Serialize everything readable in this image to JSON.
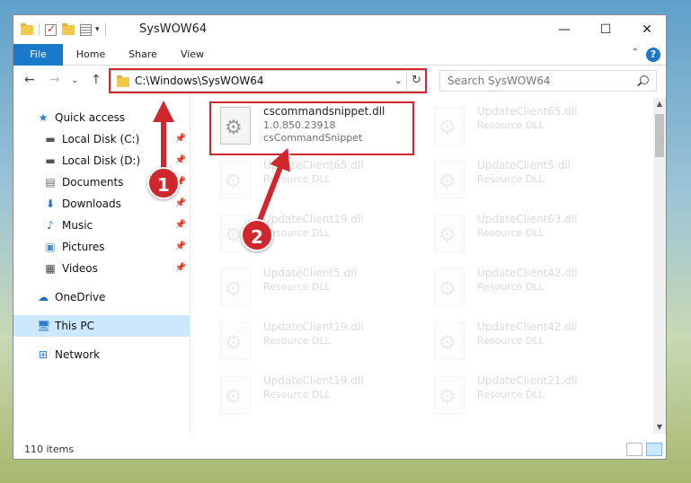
{
  "window": {
    "title": "SysWOW64",
    "minimize_glyph": "—",
    "maximize_glyph": "☐",
    "close_glyph": "✕"
  },
  "ribbon": {
    "tabs": [
      "File",
      "Home",
      "Share",
      "View"
    ],
    "help_glyph": "?",
    "collapse_glyph": "⌃"
  },
  "nav": {
    "back_glyph": "←",
    "forward_glyph": "→",
    "recent_glyph": "⌄",
    "up_glyph": "↑",
    "address_path": "C:\\Windows\\SysWOW64",
    "address_drop_glyph": "⌄",
    "refresh_glyph": "↻",
    "search_placeholder": "Search SysWOW64"
  },
  "sidebar": {
    "items": [
      {
        "label": "Quick access",
        "icon": "star-icon",
        "glyph": "★",
        "color": "#2b7cd3",
        "pinned": false
      },
      {
        "label": "Local Disk (C:)",
        "icon": "drive-icon",
        "glyph": "▬",
        "color": "#555555",
        "pinned": true
      },
      {
        "label": "Local Disk (D:)",
        "icon": "drive-icon",
        "glyph": "▬",
        "color": "#555555",
        "pinned": true
      },
      {
        "label": "Documents",
        "icon": "documents-icon",
        "glyph": "▤",
        "color": "#6a6a6a",
        "pinned": true
      },
      {
        "label": "Downloads",
        "icon": "download-icon",
        "glyph": "⬇",
        "color": "#1f6fc4",
        "pinned": true
      },
      {
        "label": "Music",
        "icon": "music-icon",
        "glyph": "♪",
        "color": "#1f6fc4",
        "pinned": true
      },
      {
        "label": "Pictures",
        "icon": "pictures-icon",
        "glyph": "▣",
        "color": "#4a8fc9",
        "pinned": true
      },
      {
        "label": "Videos",
        "icon": "video-icon",
        "glyph": "▦",
        "color": "#444444",
        "pinned": true
      },
      {
        "label": "OneDrive",
        "icon": "cloud-icon",
        "glyph": "☁",
        "color": "#1f6fc4",
        "pinned": false
      },
      {
        "label": "This PC",
        "icon": "computer-icon",
        "glyph": "🖥",
        "color": "#2b7cd3",
        "pinned": false
      },
      {
        "label": "Network",
        "icon": "network-icon",
        "glyph": "⊞",
        "color": "#2b7cd3",
        "pinned": false
      }
    ],
    "pin_glyph": "📌"
  },
  "files": [
    {
      "name": "cscommandsnippet.dll",
      "version": "1.0.850.23918",
      "description": "csCommandSnippet",
      "faded": false
    },
    {
      "name": "UpdateClient65.dll",
      "version": "Resource DLL",
      "description": "",
      "faded": true
    },
    {
      "name": "UpdateClient65.dll",
      "version": "Resource DLL",
      "description": "",
      "faded": true
    },
    {
      "name": "UpdateClient5.dll",
      "version": "Resource DLL",
      "description": "",
      "faded": true
    },
    {
      "name": "UpdateClient19.dll",
      "version": "Resource DLL",
      "description": "",
      "faded": true
    },
    {
      "name": "UpdateClient63.dll",
      "version": "Resource DLL",
      "description": "",
      "faded": true
    },
    {
      "name": "UpdateClient5.dll",
      "version": "Resource DLL",
      "description": "",
      "faded": true
    },
    {
      "name": "UpdateClient42.dll",
      "version": "Resource DLL",
      "description": "",
      "faded": true
    },
    {
      "name": "UpdateClient19.dll",
      "version": "Resource DLL",
      "description": "",
      "faded": true
    },
    {
      "name": "UpdateClient42.dll",
      "version": "Resource DLL",
      "description": "",
      "faded": true
    },
    {
      "name": "UpdateClient19.dll",
      "version": "Resource DLL",
      "description": "",
      "faded": true
    },
    {
      "name": "UpdateClient21.dll",
      "version": "Resource DLL",
      "description": "",
      "faded": true
    }
  ],
  "scroll": {
    "up_glyph": "▲",
    "down_glyph": "▼"
  },
  "status": {
    "item_count": "110 items"
  },
  "callouts": {
    "step1": "1",
    "step2": "2",
    "color": "#d0272d"
  }
}
